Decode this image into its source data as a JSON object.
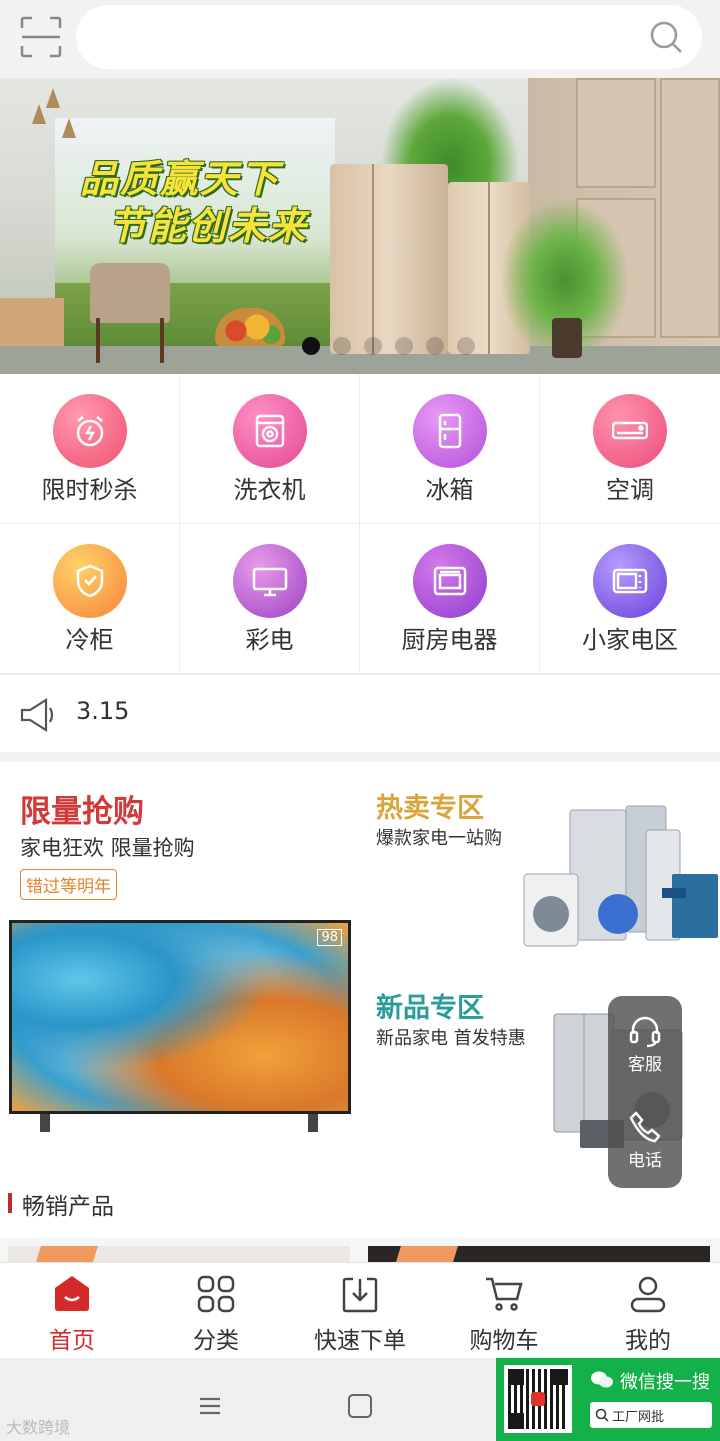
{
  "banner": {
    "slogan_line1": "品质赢天下",
    "slogan_line2": "节能创未来",
    "slide_count": 6,
    "active_slide": 1
  },
  "categories": [
    {
      "label": "限时秒杀",
      "icon": "alarm-clock-icon",
      "color": "#f0506e"
    },
    {
      "label": "洗衣机",
      "icon": "washing-machine-icon",
      "color": "#e34796"
    },
    {
      "label": "冰箱",
      "icon": "fridge-icon",
      "color": "#b44fd8"
    },
    {
      "label": "空调",
      "icon": "air-conditioner-icon",
      "color": "#ec4c7a"
    },
    {
      "label": "冷柜",
      "icon": "freezer-icon",
      "color": "#f7833b"
    },
    {
      "label": "彩电",
      "icon": "tv-icon",
      "color": "#9b43c4"
    },
    {
      "label": "厨房电器",
      "icon": "oven-icon",
      "color": "#8f3ccf"
    },
    {
      "label": "小家电区",
      "icon": "microwave-icon",
      "color": "#6a3fd8"
    }
  ],
  "notice": {
    "text": "3.15"
  },
  "promo": {
    "limited": {
      "title": "限量抢购",
      "subtitle": "家电狂欢  限量抢购",
      "tag": "错过等明年",
      "tv_badge": "98"
    },
    "hot": {
      "title": "热卖专区",
      "subtitle": "爆款家电一站购"
    },
    "new": {
      "title": "新品专区",
      "subtitle": "新品家电 首发特惠"
    }
  },
  "bestseller": {
    "title": "畅销产品"
  },
  "float_service": {
    "service": "客服",
    "phone": "电话"
  },
  "tabs": [
    {
      "label": "首页",
      "active": true
    },
    {
      "label": "分类",
      "active": false
    },
    {
      "label": "快速下单",
      "active": false
    },
    {
      "label": "购物车",
      "active": false
    },
    {
      "label": "我的",
      "active": false
    }
  ],
  "watermark": "大数跨境",
  "wechat": {
    "title": "微信搜一搜",
    "search_text": "工厂网批"
  },
  "colors": {
    "accent_red": "#d42a2a",
    "wechat_green": "#14b14b"
  }
}
